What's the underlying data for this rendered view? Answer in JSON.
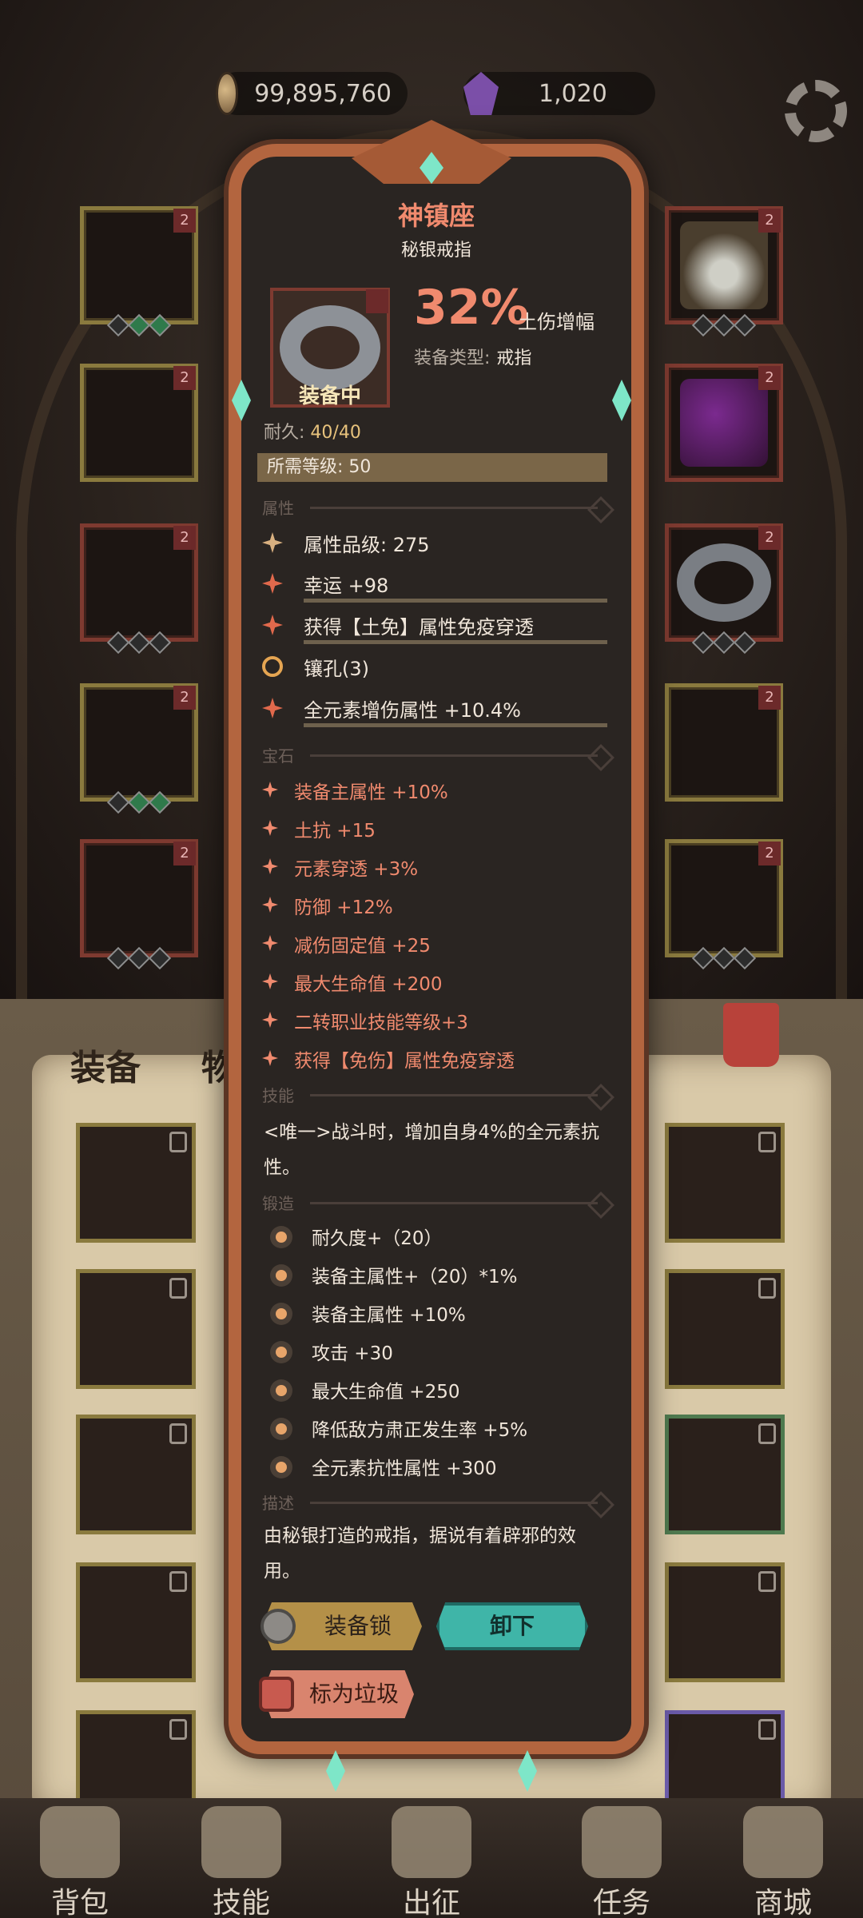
{
  "currency": {
    "coins": "99,895,760",
    "gems": "1,020"
  },
  "slot_badge": "2",
  "tabs": {
    "equipment": "装备",
    "items": "物品"
  },
  "item": {
    "name": "神镇座",
    "subtype": "秘银戒指",
    "equipped_label": "装备中",
    "percent": "32%",
    "percent_label": "土伤增幅",
    "type_label": "装备类型:",
    "type_value": "戒指",
    "durability_label": "耐久:",
    "durability_value": "40/40",
    "required_level": "所需等级: 50"
  },
  "sections": {
    "attributes": "属性",
    "gems": "宝石",
    "skills": "技能",
    "forge": "锻造",
    "description": "描述"
  },
  "attributes": [
    {
      "icon": "quality-emblem-icon",
      "text": "属性品级: 275"
    },
    {
      "icon": "sparkle-icon",
      "text": "幸运 +98"
    },
    {
      "icon": "sparkle-icon",
      "text": "获得【土免】属性免疫穿透"
    },
    {
      "icon": "swirl-icon",
      "text": "镶孔(3)"
    },
    {
      "icon": "sparkle-icon",
      "text": "全元素增伤属性 +10.4%"
    }
  ],
  "gem_stats": [
    "装备主属性 +10%",
    "土抗 +15",
    "元素穿透 +3%",
    "防御 +12%",
    "减伤固定值 +25",
    "最大生命值 +200",
    "二转职业技能等级+3",
    "获得【免伤】属性免疫穿透"
  ],
  "skill_text": "<唯一>战斗时，增加自身4%的全元素抗性。",
  "forge_stats": [
    "耐久度+（20）",
    "装备主属性+（20）*1%",
    "装备主属性 +10%",
    "攻击 +30",
    "最大生命值 +250",
    "降低敌方肃正发生率 +5%",
    "全元素抗性属性 +300"
  ],
  "description": "由秘银打造的戒指，据说有着辟邪的效用。",
  "buttons": {
    "lock": "装备锁",
    "unequip": "卸下",
    "mark_trash": "标为垃圾"
  },
  "nav": [
    "背包",
    "技能",
    "出征",
    "任务",
    "商城"
  ],
  "colors": {
    "accent_orange": "#f08a6e",
    "teal_button": "#3fb5a8",
    "frame_copper": "#b3653f"
  }
}
